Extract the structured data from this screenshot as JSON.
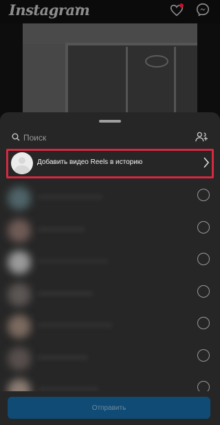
{
  "app": {
    "brand": "Instagram"
  },
  "sheet": {
    "search_placeholder": "Поиск",
    "reels_row_label": "Добавить видео Reels в историю",
    "send_label": "Отправить"
  },
  "contacts": [
    {
      "avatar_color": "#4f6469",
      "name_color": "#2f2f2f"
    },
    {
      "avatar_color": "#6f5b56",
      "name_color": "#303030"
    },
    {
      "avatar_color": "#9a9a9a",
      "name_color": "#2e2e2e"
    },
    {
      "avatar_color": "#5c5654",
      "name_color": "#303030"
    },
    {
      "avatar_color": "#7b6a5f",
      "name_color": "#2f2f2f"
    },
    {
      "avatar_color": "#574f4d",
      "name_color": "#303030"
    },
    {
      "avatar_color": "#8a7c72",
      "name_color": "#2f2f2f"
    }
  ],
  "colors": {
    "highlight": "#d6283e",
    "sheet_bg": "#262626",
    "send_button": "#0f4b74",
    "notification_dot": "#c8102e"
  }
}
